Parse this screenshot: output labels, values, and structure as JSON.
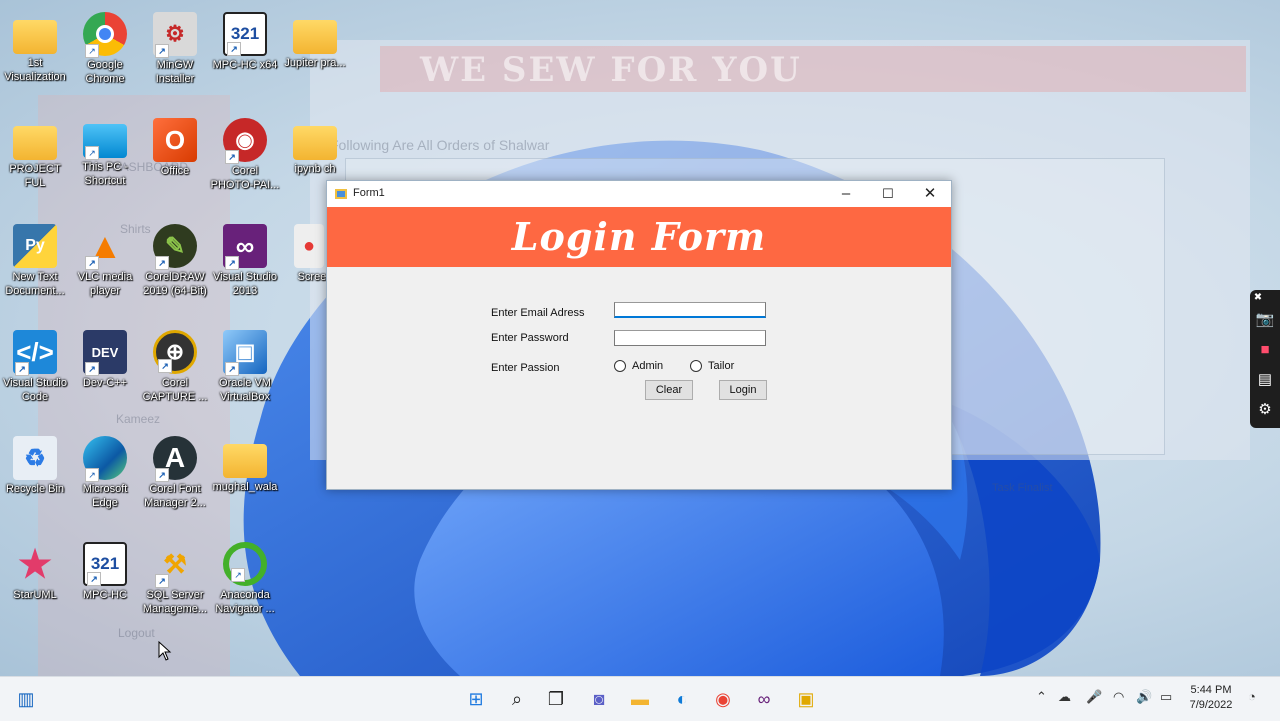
{
  "colors": {
    "banner": "#fe6842",
    "focus_accent": "#0078d7",
    "taskbar": "#f2f4f7"
  },
  "background_app": {
    "banner_title": "WE SEW FOR YOU",
    "heading": "Following Are All Orders of Shalwar",
    "sidebar_items": [
      "DASHBOARD",
      "Shirts",
      "Kameez",
      "Logout"
    ],
    "status_text": "Task Finalist"
  },
  "desktop_icons": [
    {
      "label": "1st Visualization",
      "icon": "folder-icon"
    },
    {
      "label": "Google Chrome",
      "icon": "chrome-icon"
    },
    {
      "label": "MinGW Installer",
      "icon": "installer-icon"
    },
    {
      "label": "MPC-HC x64",
      "icon": "mpc-icon"
    },
    {
      "label": "Jupiter pra...",
      "icon": "folder-icon"
    },
    {
      "label": "PROJECT FUL",
      "icon": "folder-icon"
    },
    {
      "label": "This PC - Shortcut",
      "icon": "monitor-icon"
    },
    {
      "label": "Office",
      "icon": "office-icon"
    },
    {
      "label": "Corel PHOTO-PAI...",
      "icon": "camera-icon"
    },
    {
      "label": "ipynb ch",
      "icon": "folder-icon"
    },
    {
      "label": "New Text Document...",
      "icon": "python-icon"
    },
    {
      "label": "VLC media player",
      "icon": "vlc-icon"
    },
    {
      "label": "CorelDRAW 2019 (64-Bit)",
      "icon": "coreldraw-icon"
    },
    {
      "label": "Visual Studio 2013",
      "icon": "visual-studio-icon"
    },
    {
      "label": "Screen",
      "icon": "record-icon"
    },
    {
      "label": "Visual Studio Code",
      "icon": "vscode-icon"
    },
    {
      "label": "Dev-C++",
      "icon": "devcpp-icon"
    },
    {
      "label": "Corel CAPTURE ...",
      "icon": "corel-capture-icon"
    },
    {
      "label": "Oracle VM VirtualBox",
      "icon": "virtualbox-icon"
    },
    {
      "label": "Recycle Bin",
      "icon": "recycle-bin-icon"
    },
    {
      "label": "Microsoft Edge",
      "icon": "edge-icon"
    },
    {
      "label": "Corel Font Manager 2...",
      "icon": "corel-font-icon"
    },
    {
      "label": "mughal_wala",
      "icon": "folder-icon"
    },
    {
      "label": "StarUML",
      "icon": "staruml-icon"
    },
    {
      "label": "MPC-HC",
      "icon": "mpc-icon"
    },
    {
      "label": "SQL Server Manageme...",
      "icon": "sql-server-icon"
    },
    {
      "label": "Anaconda Navigator ...",
      "icon": "anaconda-icon"
    }
  ],
  "form": {
    "window_title": "Form1",
    "banner_title": "Login Form",
    "email_label": "Enter Email Adress",
    "email_value": "",
    "password_label": "Enter Password",
    "password_value": "",
    "passion_label": "Enter Passion",
    "radio_admin": "Admin",
    "radio_tailor": "Tailor",
    "clear_button": "Clear",
    "login_button": "Login"
  },
  "taskbar": {
    "time": "5:44 PM",
    "date": "7/9/2022"
  }
}
